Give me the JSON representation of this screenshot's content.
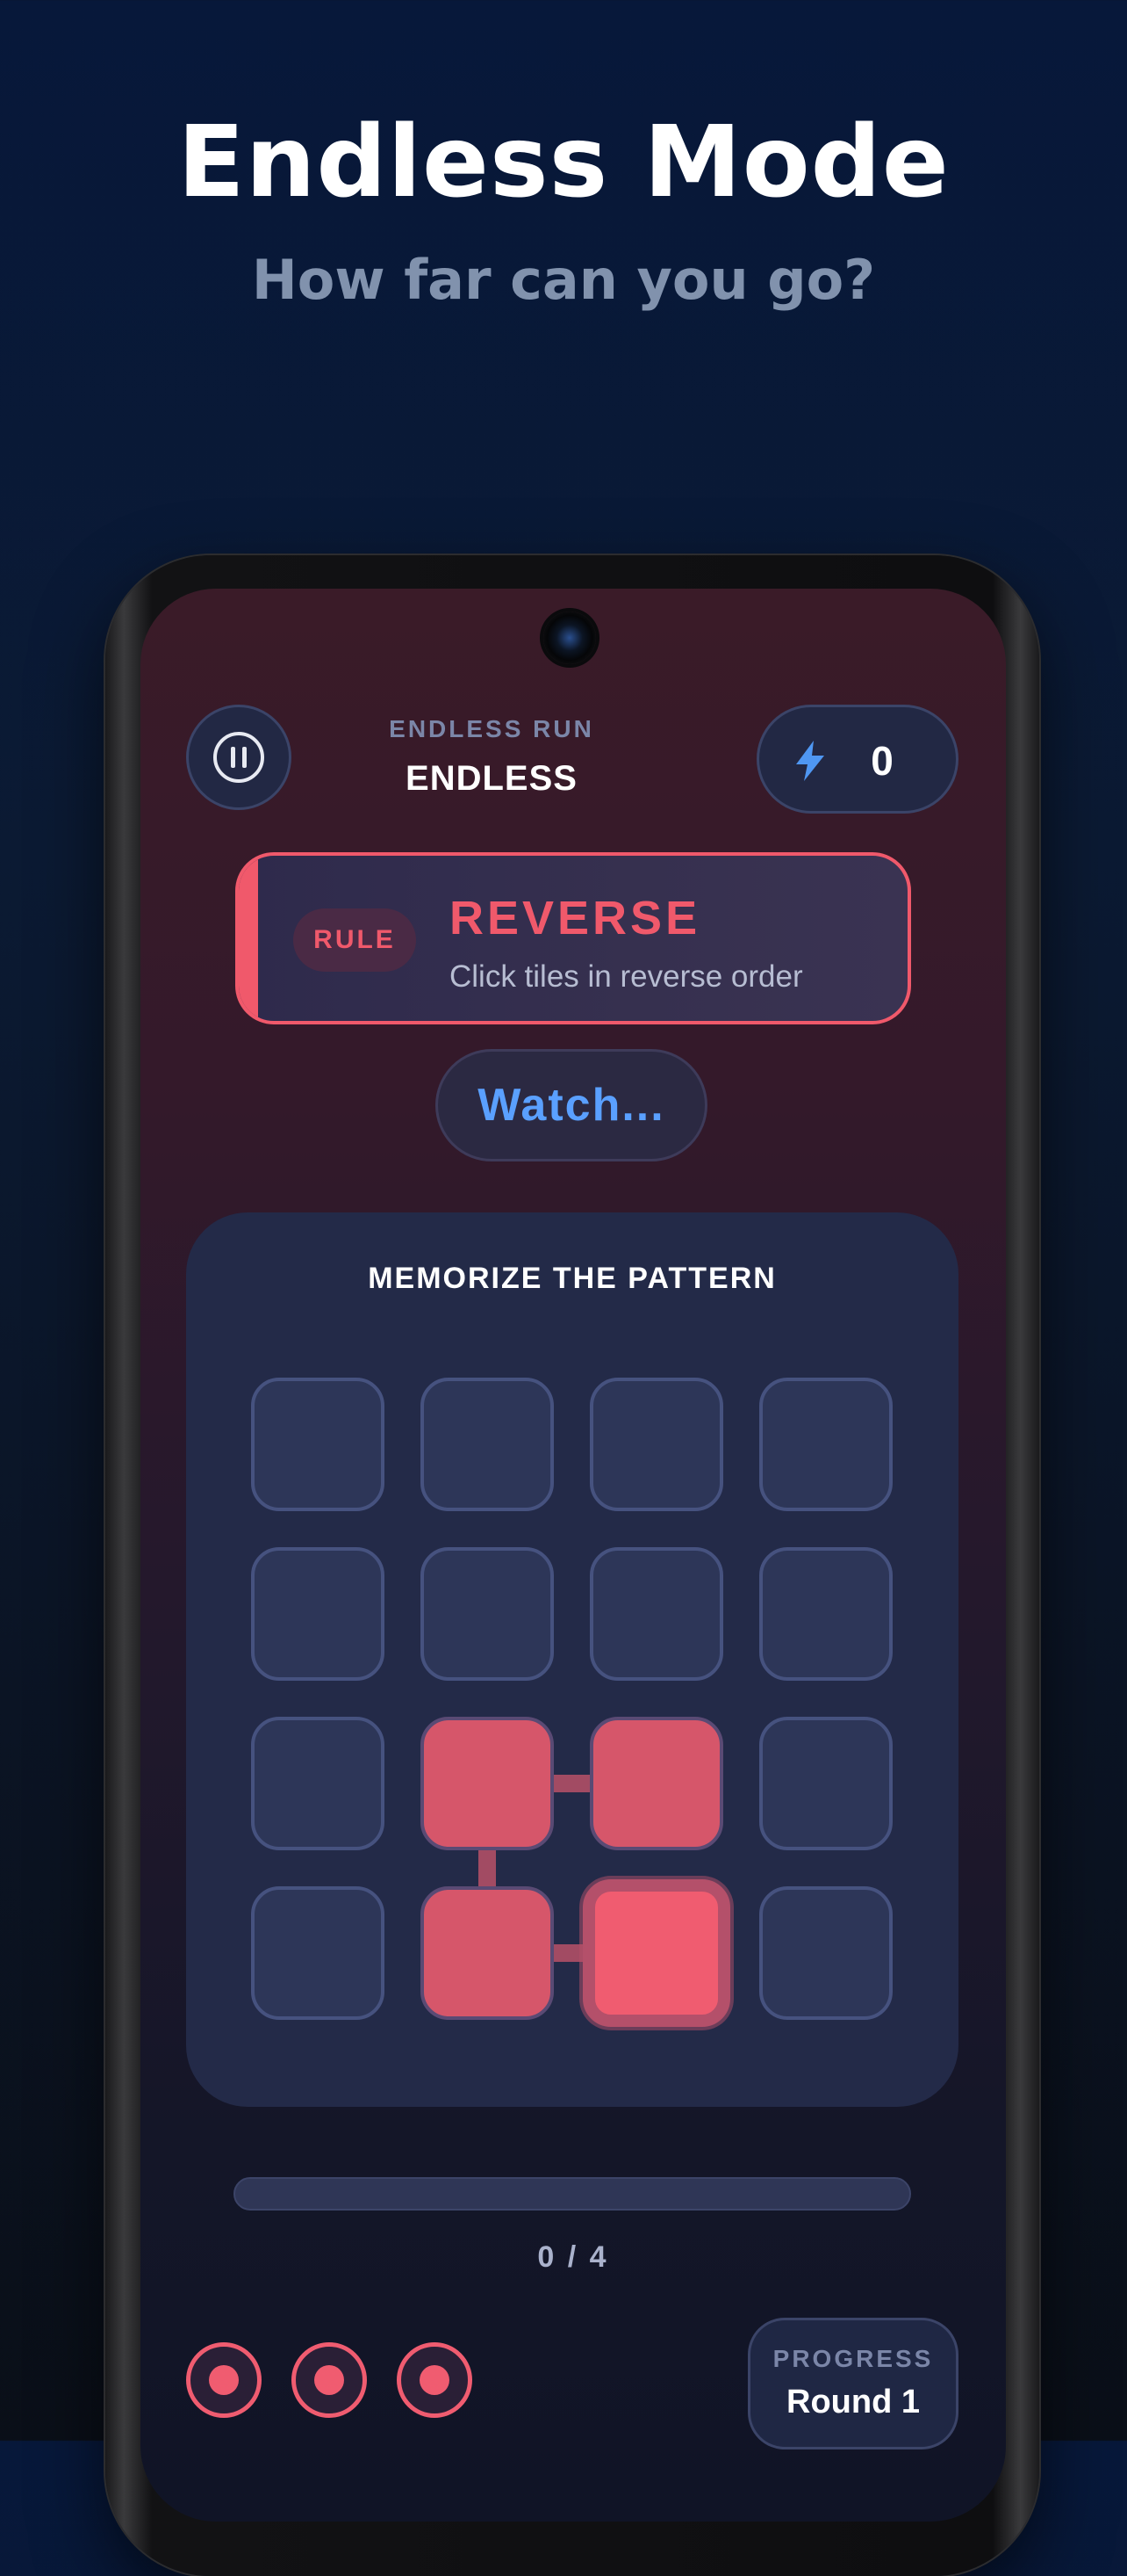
{
  "promo": {
    "headline": "Endless Mode",
    "subheadline": "How far can you go?"
  },
  "header": {
    "pause_icon": "pause-icon",
    "run_label": "ENDLESS RUN",
    "run_name": "ENDLESS",
    "score_icon": "lightning-bolt-icon",
    "score": "0"
  },
  "rule": {
    "badge": "RULE",
    "title": "REVERSE",
    "description": "Click tiles in reverse order"
  },
  "status": {
    "label": "Watch..."
  },
  "board": {
    "title": "MEMORIZE THE PATTERN",
    "grid_size": 4,
    "tiles": [
      "off",
      "off",
      "off",
      "off",
      "off",
      "off",
      "off",
      "off",
      "off",
      "lit",
      "lit",
      "off",
      "off",
      "lit",
      "active",
      "off"
    ]
  },
  "progress": {
    "text": "0 / 4",
    "fraction": 0
  },
  "lives": {
    "count": 3,
    "icon": "life-orb-icon"
  },
  "round": {
    "label": "PROGRESS",
    "value": "Round 1"
  },
  "colors": {
    "accent": "#f05c70",
    "blue": "#5aa0ff",
    "tile": "#2d3658",
    "panel": "#232a48"
  }
}
